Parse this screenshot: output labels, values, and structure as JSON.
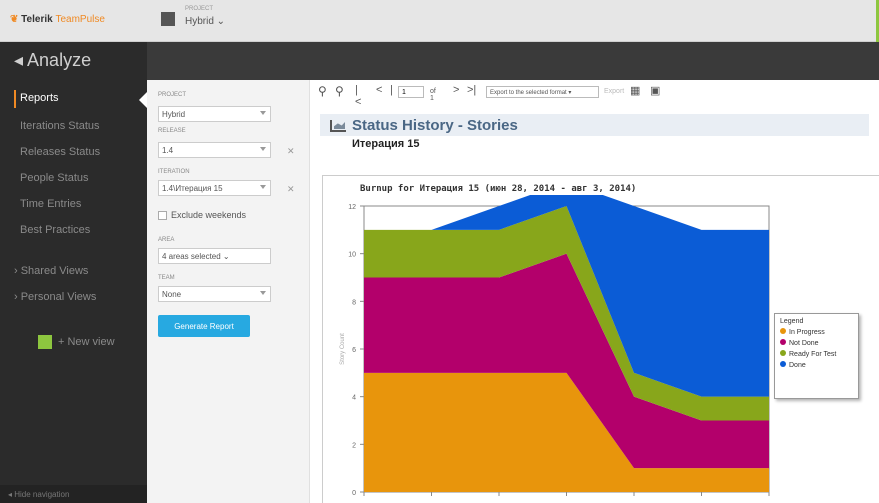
{
  "topbar": {
    "logo_brand": "Telerik",
    "logo_product": "TeamPulse",
    "project_caption": "PROJECT",
    "project_name": "Hybrid ⌄"
  },
  "sidebar": {
    "title": "◂ Analyze",
    "items": [
      {
        "label": "Reports",
        "active": true
      },
      {
        "label": "Iterations Status",
        "active": false
      },
      {
        "label": "Releases Status",
        "active": false
      },
      {
        "label": "People Status",
        "active": false
      },
      {
        "label": "Time Entries",
        "active": false
      },
      {
        "label": "Best Practices",
        "active": false
      },
      {
        "label": "› Shared Views",
        "active": false
      },
      {
        "label": "› Personal Views",
        "active": false
      }
    ],
    "new_view_label": "+ New view",
    "collapse_label": "◂ Hide navigation"
  },
  "options": {
    "project_label": "PROJECT",
    "project_value": "Hybrid",
    "release_label": "RELEASE",
    "release_value": "1.4",
    "iteration_label": "ITERATION",
    "iteration_value": "1.4\\Итерация 15",
    "exclude_weekends_label": "Exclude weekends",
    "area_label": "AREA",
    "area_value": "4 areas selected ⌄",
    "team_label": "TEAM",
    "team_value": "None",
    "generate_label": "Generate Report",
    "clear_symbol": "✕"
  },
  "report": {
    "toolbar": {
      "first_page": "|<",
      "prev_page": "<",
      "page_value": "1",
      "page_of": "of 1",
      "next_page": ">",
      "last_page": ">|",
      "export_placeholder": "Export to the selected format ▾",
      "export_label": "Export"
    },
    "title": "Status History - Stories",
    "subtitle": "Итерация 15"
  },
  "chart_data": {
    "type": "area",
    "title": "Burnup for Итерация 15 (июн 28, 2014 - авг 3, 2014)",
    "ylabel": "Story Count",
    "ylim": [
      0,
      12
    ],
    "yticks": [
      "0",
      "2",
      "4",
      "6",
      "8",
      "10",
      "12"
    ],
    "x": [
      0,
      1,
      2,
      3,
      4,
      5,
      6
    ],
    "series": [
      {
        "name": "In Progress",
        "color": "#e8950c",
        "values": [
          5,
          5,
          5,
          5,
          1,
          1,
          1
        ]
      },
      {
        "name": "Not Done",
        "color": "#b3006b",
        "values": [
          4,
          4,
          4,
          5,
          3,
          2,
          2
        ]
      },
      {
        "name": "Ready For Test",
        "color": "#88a61b",
        "values": [
          2,
          2,
          2,
          2,
          1,
          1,
          1
        ]
      },
      {
        "name": "Done",
        "color": "#0b5cd6",
        "values": [
          0,
          0,
          1,
          1,
          7,
          7,
          7
        ]
      }
    ],
    "legend_title": "Legend",
    "legend_position": "right"
  }
}
